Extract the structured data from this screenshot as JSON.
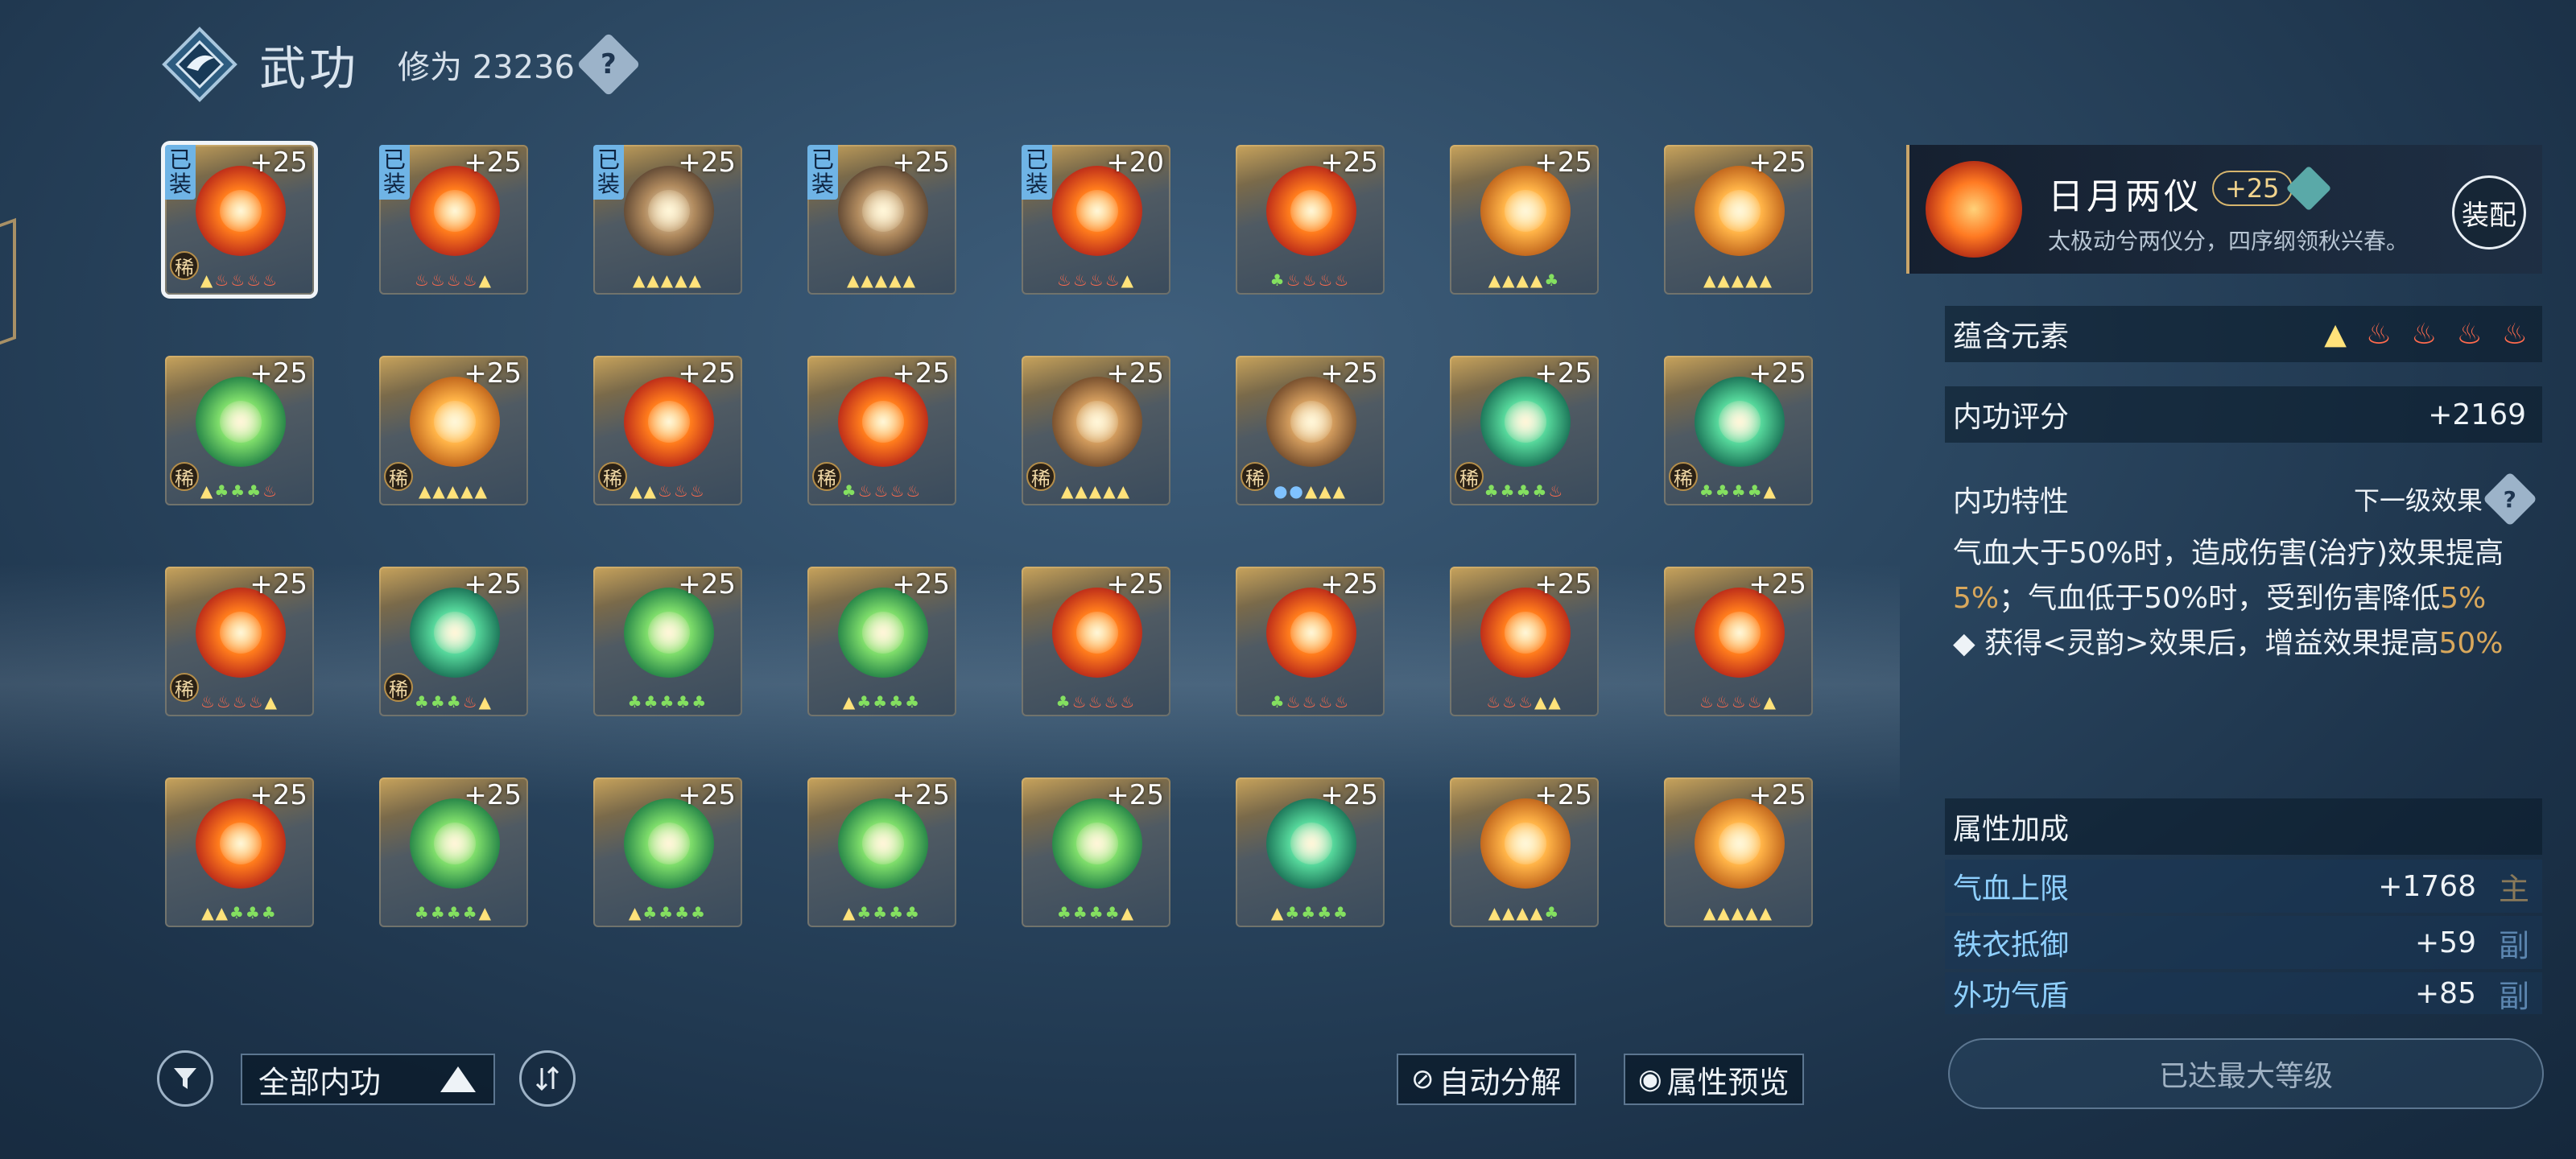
{
  "header": {
    "title": "武功",
    "cultivation": "修为 23236",
    "help": "?"
  },
  "cards": [
    {
      "level": "+25",
      "equipped": "已装",
      "rare": "稀",
      "orb": "fire",
      "selected": true,
      "elements": [
        [
          "▲",
          "m"
        ],
        [
          "♨",
          "f"
        ],
        [
          "♨",
          "f"
        ],
        [
          "♨",
          "f"
        ],
        [
          "♨",
          "f"
        ]
      ]
    },
    {
      "level": "+25",
      "equipped": "已装",
      "rare": "",
      "orb": "fire",
      "elements": [
        [
          "♨",
          "f"
        ],
        [
          "♨",
          "f"
        ],
        [
          "♨",
          "f"
        ],
        [
          "♨",
          "f"
        ],
        [
          "▲",
          "m"
        ]
      ]
    },
    {
      "level": "+25",
      "equipped": "已装",
      "rare": "",
      "orb": "rock",
      "elements": [
        [
          "▲",
          "m"
        ],
        [
          "▲",
          "m"
        ],
        [
          "▲",
          "m"
        ],
        [
          "▲",
          "m"
        ],
        [
          "▲",
          "m"
        ]
      ]
    },
    {
      "level": "+25",
      "equipped": "已装",
      "rare": "",
      "orb": "rock",
      "elements": [
        [
          "▲",
          "m"
        ],
        [
          "▲",
          "m"
        ],
        [
          "▲",
          "m"
        ],
        [
          "▲",
          "m"
        ],
        [
          "▲",
          "m"
        ]
      ]
    },
    {
      "level": "+20",
      "equipped": "已装",
      "rare": "",
      "orb": "fire",
      "elements": [
        [
          "♨",
          "f"
        ],
        [
          "♨",
          "f"
        ],
        [
          "♨",
          "f"
        ],
        [
          "♨",
          "f"
        ],
        [
          "▲",
          "m"
        ]
      ]
    },
    {
      "level": "+25",
      "equipped": "",
      "rare": "",
      "orb": "fire",
      "elements": [
        [
          "♣",
          "w"
        ],
        [
          "♨",
          "f"
        ],
        [
          "♨",
          "f"
        ],
        [
          "♨",
          "f"
        ],
        [
          "♨",
          "f"
        ]
      ]
    },
    {
      "level": "+25",
      "equipped": "",
      "rare": "",
      "orb": "gold",
      "elements": [
        [
          "▲",
          "m"
        ],
        [
          "▲",
          "m"
        ],
        [
          "▲",
          "m"
        ],
        [
          "▲",
          "m"
        ],
        [
          "♣",
          "w"
        ]
      ]
    },
    {
      "level": "+25",
      "equipped": "",
      "rare": "",
      "orb": "gold",
      "elements": [
        [
          "▲",
          "m"
        ],
        [
          "▲",
          "m"
        ],
        [
          "▲",
          "m"
        ],
        [
          "▲",
          "m"
        ],
        [
          "▲",
          "m"
        ]
      ]
    },
    {
      "level": "+25",
      "equipped": "",
      "rare": "稀",
      "orb": "green",
      "elements": [
        [
          "▲",
          "m"
        ],
        [
          "♣",
          "w"
        ],
        [
          "♣",
          "w"
        ],
        [
          "♣",
          "w"
        ],
        [
          "♨",
          "f"
        ]
      ]
    },
    {
      "level": "+25",
      "equipped": "",
      "rare": "稀",
      "orb": "gold",
      "elements": [
        [
          "▲",
          "m"
        ],
        [
          "▲",
          "m"
        ],
        [
          "▲",
          "m"
        ],
        [
          "▲",
          "m"
        ],
        [
          "▲",
          "m"
        ]
      ]
    },
    {
      "level": "+25",
      "equipped": "",
      "rare": "稀",
      "orb": "fire",
      "elements": [
        [
          "▲",
          "m"
        ],
        [
          "▲",
          "m"
        ],
        [
          "♨",
          "f"
        ],
        [
          "♨",
          "f"
        ],
        [
          "♨",
          "f"
        ]
      ]
    },
    {
      "level": "+25",
      "equipped": "",
      "rare": "稀",
      "orb": "fire",
      "elements": [
        [
          "♣",
          "w"
        ],
        [
          "♨",
          "f"
        ],
        [
          "♨",
          "f"
        ],
        [
          "♨",
          "f"
        ],
        [
          "♨",
          "f"
        ]
      ]
    },
    {
      "level": "+25",
      "equipped": "",
      "rare": "稀",
      "orb": "bronze",
      "elements": [
        [
          "▲",
          "m"
        ],
        [
          "▲",
          "m"
        ],
        [
          "▲",
          "m"
        ],
        [
          "▲",
          "m"
        ],
        [
          "▲",
          "m"
        ]
      ]
    },
    {
      "level": "+25",
      "equipped": "",
      "rare": "稀",
      "orb": "bronze",
      "elements": [
        [
          "●",
          "s"
        ],
        [
          "●",
          "s"
        ],
        [
          "▲",
          "m"
        ],
        [
          "▲",
          "m"
        ],
        [
          "▲",
          "m"
        ]
      ]
    },
    {
      "level": "+25",
      "equipped": "",
      "rare": "稀",
      "orb": "jade",
      "elements": [
        [
          "♣",
          "w"
        ],
        [
          "♣",
          "w"
        ],
        [
          "♣",
          "w"
        ],
        [
          "♣",
          "w"
        ],
        [
          "♨",
          "f"
        ]
      ]
    },
    {
      "level": "+25",
      "equipped": "",
      "rare": "稀",
      "orb": "jade",
      "elements": [
        [
          "♣",
          "w"
        ],
        [
          "♣",
          "w"
        ],
        [
          "♣",
          "w"
        ],
        [
          "♣",
          "w"
        ],
        [
          "▲",
          "m"
        ]
      ]
    },
    {
      "level": "+25",
      "equipped": "",
      "rare": "稀",
      "orb": "fire",
      "elements": [
        [
          "♨",
          "f"
        ],
        [
          "♨",
          "f"
        ],
        [
          "♨",
          "f"
        ],
        [
          "♨",
          "f"
        ],
        [
          "▲",
          "m"
        ]
      ]
    },
    {
      "level": "+25",
      "equipped": "",
      "rare": "稀",
      "orb": "jade",
      "elements": [
        [
          "♣",
          "w"
        ],
        [
          "♣",
          "w"
        ],
        [
          "♣",
          "w"
        ],
        [
          "♨",
          "f"
        ],
        [
          "▲",
          "m"
        ]
      ]
    },
    {
      "level": "+25",
      "equipped": "",
      "rare": "",
      "orb": "green",
      "elements": [
        [
          "♣",
          "w"
        ],
        [
          "♣",
          "w"
        ],
        [
          "♣",
          "w"
        ],
        [
          "♣",
          "w"
        ],
        [
          "♣",
          "w"
        ]
      ]
    },
    {
      "level": "+25",
      "equipped": "",
      "rare": "",
      "orb": "green",
      "elements": [
        [
          "▲",
          "m"
        ],
        [
          "♣",
          "w"
        ],
        [
          "♣",
          "w"
        ],
        [
          "♣",
          "w"
        ],
        [
          "♣",
          "w"
        ]
      ]
    },
    {
      "level": "+25",
      "equipped": "",
      "rare": "",
      "orb": "fire",
      "elements": [
        [
          "♣",
          "w"
        ],
        [
          "♨",
          "f"
        ],
        [
          "♨",
          "f"
        ],
        [
          "♨",
          "f"
        ],
        [
          "♨",
          "f"
        ]
      ]
    },
    {
      "level": "+25",
      "equipped": "",
      "rare": "",
      "orb": "fire",
      "elements": [
        [
          "♣",
          "w"
        ],
        [
          "♨",
          "f"
        ],
        [
          "♨",
          "f"
        ],
        [
          "♨",
          "f"
        ],
        [
          "♨",
          "f"
        ]
      ]
    },
    {
      "level": "+25",
      "equipped": "",
      "rare": "",
      "orb": "fire",
      "elements": [
        [
          "♨",
          "f"
        ],
        [
          "♨",
          "f"
        ],
        [
          "♨",
          "f"
        ],
        [
          "▲",
          "m"
        ],
        [
          "▲",
          "m"
        ]
      ]
    },
    {
      "level": "+25",
      "equipped": "",
      "rare": "",
      "orb": "fire",
      "elements": [
        [
          "♨",
          "f"
        ],
        [
          "♨",
          "f"
        ],
        [
          "♨",
          "f"
        ],
        [
          "♨",
          "f"
        ],
        [
          "▲",
          "m"
        ]
      ]
    },
    {
      "level": "+25",
      "equipped": "",
      "rare": "",
      "orb": "fire",
      "elements": [
        [
          "▲",
          "m"
        ],
        [
          "▲",
          "m"
        ],
        [
          "♣",
          "w"
        ],
        [
          "♣",
          "w"
        ],
        [
          "♣",
          "w"
        ]
      ]
    },
    {
      "level": "+25",
      "equipped": "",
      "rare": "",
      "orb": "green",
      "elements": [
        [
          "♣",
          "w"
        ],
        [
          "♣",
          "w"
        ],
        [
          "♣",
          "w"
        ],
        [
          "♣",
          "w"
        ],
        [
          "▲",
          "m"
        ]
      ]
    },
    {
      "level": "+25",
      "equipped": "",
      "rare": "",
      "orb": "green",
      "elements": [
        [
          "▲",
          "m"
        ],
        [
          "♣",
          "w"
        ],
        [
          "♣",
          "w"
        ],
        [
          "♣",
          "w"
        ],
        [
          "♣",
          "w"
        ]
      ]
    },
    {
      "level": "+25",
      "equipped": "",
      "rare": "",
      "orb": "green",
      "elements": [
        [
          "▲",
          "m"
        ],
        [
          "♣",
          "w"
        ],
        [
          "♣",
          "w"
        ],
        [
          "♣",
          "w"
        ],
        [
          "♣",
          "w"
        ]
      ]
    },
    {
      "level": "+25",
      "equipped": "",
      "rare": "",
      "orb": "green",
      "elements": [
        [
          "♣",
          "w"
        ],
        [
          "♣",
          "w"
        ],
        [
          "♣",
          "w"
        ],
        [
          "♣",
          "w"
        ],
        [
          "▲",
          "m"
        ]
      ]
    },
    {
      "level": "+25",
      "equipped": "",
      "rare": "",
      "orb": "jade",
      "elements": [
        [
          "▲",
          "m"
        ],
        [
          "♣",
          "w"
        ],
        [
          "♣",
          "w"
        ],
        [
          "♣",
          "w"
        ],
        [
          "♣",
          "w"
        ]
      ]
    },
    {
      "level": "+25",
      "equipped": "",
      "rare": "",
      "orb": "gold",
      "elements": [
        [
          "▲",
          "m"
        ],
        [
          "▲",
          "m"
        ],
        [
          "▲",
          "m"
        ],
        [
          "▲",
          "m"
        ],
        [
          "♣",
          "w"
        ]
      ]
    },
    {
      "level": "+25",
      "equipped": "",
      "rare": "",
      "orb": "gold",
      "elements": [
        [
          "▲",
          "m"
        ],
        [
          "▲",
          "m"
        ],
        [
          "▲",
          "m"
        ],
        [
          "▲",
          "m"
        ],
        [
          "▲",
          "m"
        ]
      ]
    }
  ],
  "bottom": {
    "filter_label": "全部内功",
    "auto_decompose": "自动分解",
    "attr_preview": "属性预览"
  },
  "detail": {
    "name": "日月两仪",
    "level": "+25",
    "motto": "太极动兮两仪分，四序纲领秋兴春。",
    "equip": "装配",
    "elements_label": "蕴含元素",
    "score_label": "内功评分",
    "score_value": "+2169",
    "traits_label": "内功特性",
    "next_effect": "下一级效果",
    "trait_1a": "气血大于50%时，造成伤害(治疗)效果提高",
    "trait_1b": "5%",
    "trait_1c": "；气血低于50%时，受到伤害降低",
    "trait_1d": "5%",
    "trait_2a": "◆ 获得<灵韵>效果后，增益效果提高",
    "trait_2b": "50%",
    "attr_label": "属性加成",
    "attrs": [
      {
        "name": "气血上限",
        "value": "+1768",
        "tag": "主"
      },
      {
        "name": "铁衣抵御",
        "value": "+59",
        "tag": "副"
      },
      {
        "name": "外功气盾",
        "value": "+85",
        "tag": "副"
      }
    ],
    "max_level": "已达最大等级"
  },
  "colors": {
    "accent_gold": "#c9a56a",
    "fire": "#ff6a4d",
    "metal": "#ffe27a",
    "wood": "#84e060",
    "water": "#7fc2ff"
  }
}
